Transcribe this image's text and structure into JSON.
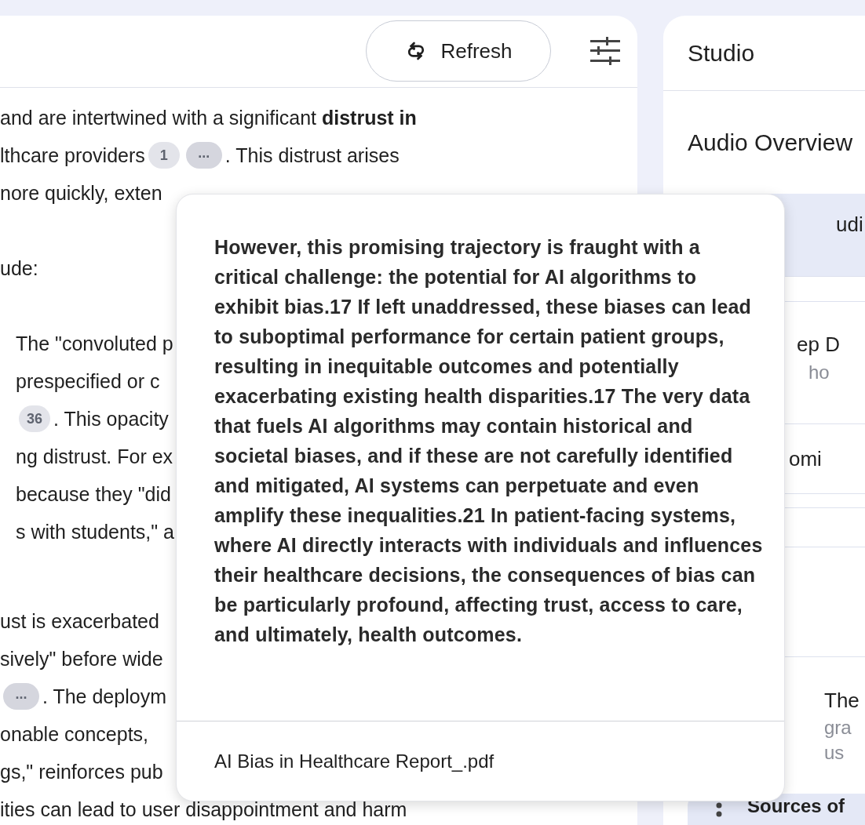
{
  "notes_panel": {
    "refresh_button": "Refresh",
    "paragraphs": [
      {
        "kind": "paragraph",
        "lines": [
          [
            {
              "kind": "text",
              "text": "and are intertwined with a significant **distrust in**"
            }
          ],
          [
            {
              "kind": "text",
              "text": "lthcare providers"
            },
            {
              "kind": "citation",
              "text": "1"
            },
            {
              "kind": "more",
              "text": "..."
            },
            {
              "kind": "text",
              "text": ". This distrust arises"
            }
          ],
          [
            {
              "kind": "text",
              "text": "nore quickly, exten"
            }
          ]
        ]
      },
      {
        "kind": "paragraph",
        "lines": [
          [
            {
              "kind": "text",
              "text": "ude:"
            }
          ]
        ]
      },
      {
        "kind": "list_item",
        "lines": [
          [
            {
              "kind": "text",
              "text": "The \"convoluted p"
            }
          ],
          [
            {
              "kind": "text",
              "text": "prespecified or c"
            }
          ],
          [
            {
              "kind": "citation",
              "text": "36"
            },
            {
              "kind": "text",
              "text": ". This opacity"
            }
          ],
          [
            {
              "kind": "text",
              "text": "ng distrust. For ex"
            }
          ],
          [
            {
              "kind": "text",
              "text": "because they \"did"
            }
          ],
          [
            {
              "kind": "text",
              "text": "s with students,\" a"
            }
          ]
        ]
      },
      {
        "kind": "paragraph",
        "lines": [
          [
            {
              "kind": "text",
              "text": "ust is exacerbated"
            }
          ],
          [
            {
              "kind": "text",
              "text": "sively\" before wide"
            }
          ],
          [
            {
              "kind": "more",
              "text": "..."
            },
            {
              "kind": "text",
              "text": ". The deploym"
            }
          ],
          [
            {
              "kind": "text",
              "text": "onable concepts,"
            }
          ],
          [
            {
              "kind": "text",
              "text": "gs,\" reinforces pub"
            }
          ],
          [
            {
              "kind": "text",
              "text": "ities can lead to user disappointment and harm"
            }
          ]
        ]
      }
    ]
  },
  "studio": {
    "title": "Studio",
    "audio_overview": {
      "title": "Audio Overview",
      "card_fragment": "udi"
    },
    "rows": [
      {
        "kind": "item",
        "title": "ep D",
        "subtitle": "ho"
      },
      {
        "kind": "single",
        "title": "omi"
      },
      {
        "kind": "spacer"
      },
      {
        "kind": "note",
        "title": "The",
        "lines": [
          "gra",
          "us"
        ]
      },
      {
        "kind": "source",
        "title": "Sources of"
      }
    ]
  },
  "citation_popover": {
    "text": "However, this promising trajectory is fraught with a critical challenge: the potential for AI algorithms to exhibit bias.17 If left unaddressed, these biases can lead to suboptimal performance for certain patient groups, resulting in inequitable outcomes and potentially exacerbating existing health disparities.17 The very data that fuels AI algorithms may contain historical and societal biases, and if these are not carefully identified and mitigated, AI systems can perpetuate and even amplify these inequalities.21 In patient-facing systems, where AI directly interacts with individuals and influences their healthcare decisions, the consequences of bias can be particularly profound, affecting trust, access to care, and ultimately, health outcomes.",
    "source": "AI Bias in Healthcare Report_.pdf"
  }
}
